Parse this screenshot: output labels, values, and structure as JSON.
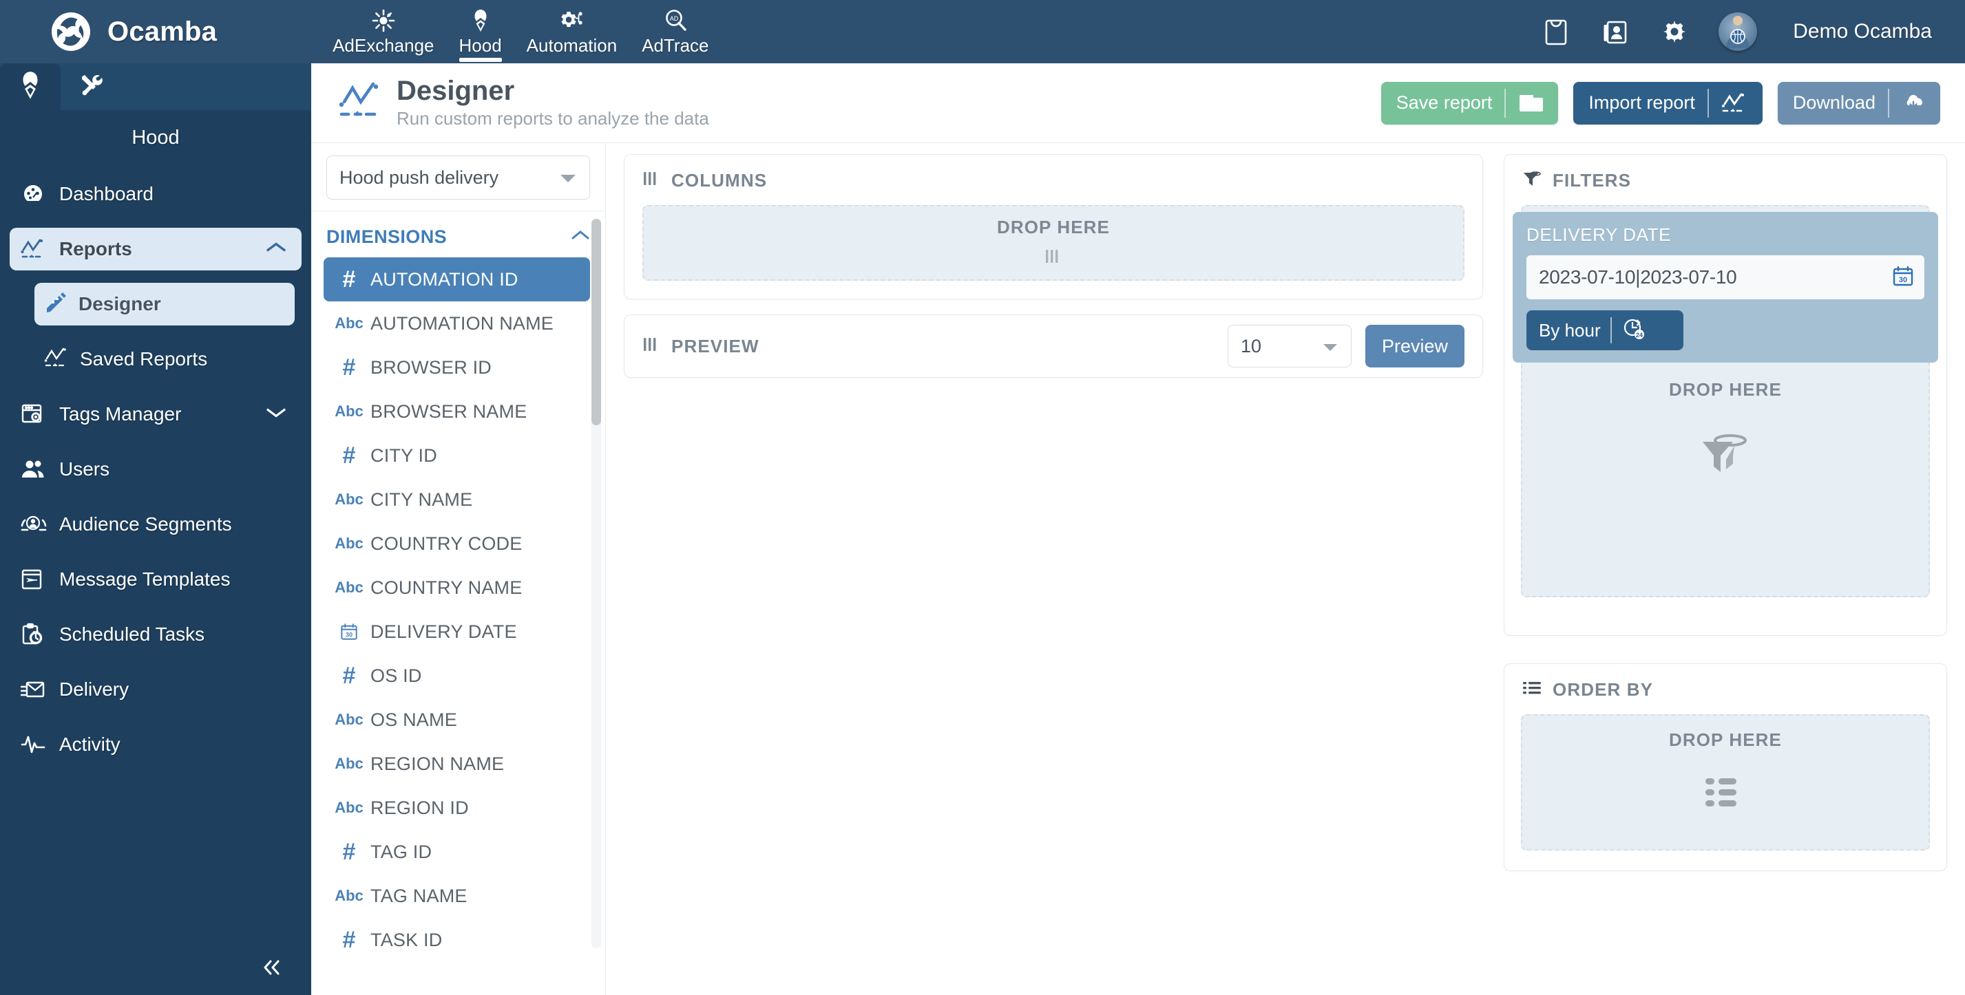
{
  "topbar": {
    "brand": "Ocamba",
    "nav": [
      {
        "label": "AdExchange",
        "icon": "adexchange-icon",
        "active": false
      },
      {
        "label": "Hood",
        "icon": "hood-icon",
        "active": true
      },
      {
        "label": "Automation",
        "icon": "automation-icon",
        "active": false
      },
      {
        "label": "AdTrace",
        "icon": "adtrace-icon",
        "active": false
      }
    ],
    "icons": [
      "shopping-bag-icon",
      "contacts-icon",
      "gear-icon"
    ],
    "user": "Demo Ocamba",
    "background_color": "#2e5070"
  },
  "sidebar": {
    "tabs": [
      "hood-tab-icon",
      "tools-tab-icon"
    ],
    "title": "Hood",
    "items": [
      {
        "label": "Dashboard",
        "icon": "dashboard-icon",
        "selected": false,
        "chevron": ""
      },
      {
        "label": "Reports",
        "icon": "reports-icon",
        "selected": true,
        "chevron": "up"
      },
      {
        "label": "Tags Manager",
        "icon": "tags-manager-icon",
        "selected": false,
        "chevron": "down"
      },
      {
        "label": "Users",
        "icon": "users-icon",
        "selected": false,
        "chevron": ""
      },
      {
        "label": "Audience Segments",
        "icon": "audience-segments-icon",
        "selected": false,
        "chevron": ""
      },
      {
        "label": "Message Templates",
        "icon": "message-templates-icon",
        "selected": false,
        "chevron": ""
      },
      {
        "label": "Scheduled Tasks",
        "icon": "scheduled-tasks-icon",
        "selected": false,
        "chevron": ""
      },
      {
        "label": "Delivery",
        "icon": "delivery-icon",
        "selected": false,
        "chevron": ""
      },
      {
        "label": "Activity",
        "icon": "activity-icon",
        "selected": false,
        "chevron": ""
      }
    ],
    "sub_items": [
      {
        "label": "Designer",
        "icon": "designer-icon",
        "selected": true
      },
      {
        "label": "Saved Reports",
        "icon": "saved-reports-icon",
        "selected": false
      }
    ],
    "collapse_icon": "double-chevron-left-icon",
    "background_color": "#1e405e"
  },
  "page_header": {
    "title": "Designer",
    "subtitle": "Run custom reports to analyze the data",
    "icon": "designer-chart-icon",
    "buttons": [
      {
        "label": "Save report",
        "icon": "folder-icon",
        "color": "#78c29a"
      },
      {
        "label": "Import report",
        "icon": "chart-icon",
        "color": "#2e5f88"
      },
      {
        "label": "Download",
        "icon": "cloud-download-icon",
        "color": "#6c8faf"
      }
    ]
  },
  "dimensions_panel": {
    "source_select": {
      "value": "Hood push delivery",
      "caret": "chevron-down-icon"
    },
    "section_label": "DIMENSIONS",
    "section_toggle": "chevron-up-icon",
    "items": [
      {
        "label": "AUTOMATION ID",
        "type": "number",
        "selected": true
      },
      {
        "label": "AUTOMATION NAME",
        "type": "text",
        "selected": false
      },
      {
        "label": "BROWSER ID",
        "type": "number",
        "selected": false
      },
      {
        "label": "BROWSER NAME",
        "type": "text",
        "selected": false
      },
      {
        "label": "CITY ID",
        "type": "number",
        "selected": false
      },
      {
        "label": "CITY NAME",
        "type": "text",
        "selected": false
      },
      {
        "label": "COUNTRY CODE",
        "type": "text",
        "selected": false
      },
      {
        "label": "COUNTRY NAME",
        "type": "text",
        "selected": false
      },
      {
        "label": "DELIVERY DATE",
        "type": "date",
        "selected": false
      },
      {
        "label": "OS ID",
        "type": "number",
        "selected": false
      },
      {
        "label": "OS NAME",
        "type": "text",
        "selected": false
      },
      {
        "label": "REGION NAME",
        "type": "text",
        "selected": false
      },
      {
        "label": "REGION ID",
        "type": "text",
        "selected": false
      },
      {
        "label": "TAG ID",
        "type": "number",
        "selected": false
      },
      {
        "label": "TAG NAME",
        "type": "text",
        "selected": false
      },
      {
        "label": "TASK ID",
        "type": "number",
        "selected": false
      }
    ],
    "type_glyphs": {
      "number": "#",
      "text": "Abc",
      "date": "30"
    }
  },
  "columns_panel": {
    "label": "COLUMNS",
    "header_icon": "columns-icon",
    "drop_text": "DROP HERE",
    "drop_icon": "columns-icon"
  },
  "preview_panel": {
    "label": "PREVIEW",
    "header_icon": "columns-icon",
    "rows_value": "10",
    "rows_caret": "chevron-down-icon",
    "button_label": "Preview"
  },
  "filters_panel": {
    "label": "FILTERS",
    "header_icon": "funnel-icon",
    "drop_text": "DROP HERE",
    "drop_icon": "funnel-icon",
    "chip": {
      "title": "DELIVERY DATE",
      "date_value": "2023-07-10|2023-07-10",
      "calendar_icon": "calendar-icon",
      "granularity_label": "By hour",
      "granularity_icon": "clock-24-icon"
    }
  },
  "orderby_panel": {
    "label": "ORDER BY",
    "header_icon": "list-icon",
    "drop_text": "DROP HERE",
    "drop_icon": "list-icon"
  }
}
